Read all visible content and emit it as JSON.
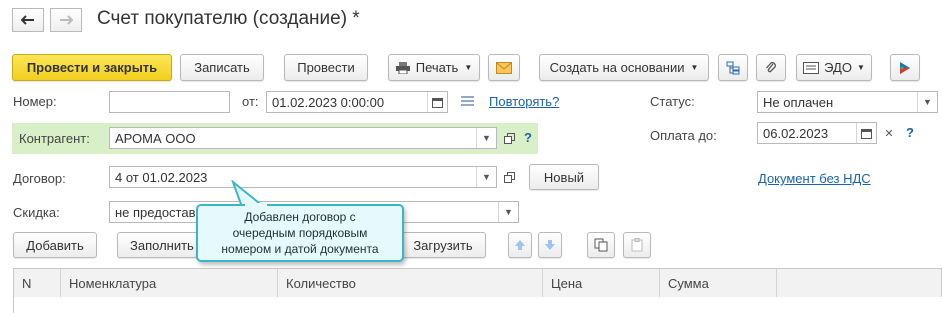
{
  "window": {
    "title": "Счет покупателю (создание) *",
    "back_icon": "arrow-left-icon",
    "forward_icon": "arrow-right-icon"
  },
  "toolbar": {
    "post_and_close": "Провести и закрыть",
    "save": "Записать",
    "post": "Провести",
    "print": "Печать",
    "create_based_on": "Создать на основании",
    "edo": "ЭДО"
  },
  "form": {
    "number_label": "Номер:",
    "number_value": "",
    "date_from_label": "от:",
    "date_value": "01.02.2023  0:00:00",
    "repeat_link": "Повторять?",
    "status_label": "Статус:",
    "status_value": "Не оплачен",
    "counterparty_label": "Контрагент:",
    "counterparty_value": "АРОМА ООО",
    "pay_until_label": "Оплата до:",
    "pay_until_value": "06.02.2023",
    "contract_label": "Договор:",
    "contract_value": "4 от 01.02.2023",
    "new_button": "Новый",
    "no_vat_link": "Документ без НДС",
    "discount_label": "Скидка:",
    "discount_value": "не предостав",
    "help": "?"
  },
  "table_toolbar": {
    "add": "Добавить",
    "fill": "Заполнить",
    "load": "Загрузить"
  },
  "table": {
    "columns": [
      "N",
      "Номенклатура",
      "Количество",
      "Цена",
      "Сумма"
    ]
  },
  "tooltip": {
    "line1": "Добавлен договор с",
    "line2": "очередным порядковым",
    "line3": "номером и датой документа"
  },
  "colors": {
    "primary_button": "#f3cf1c",
    "link": "#1a62ad",
    "counterparty_highlight": "#d9efc7",
    "tooltip_border": "#3bb6c9",
    "tooltip_background": "#e6fafd"
  }
}
